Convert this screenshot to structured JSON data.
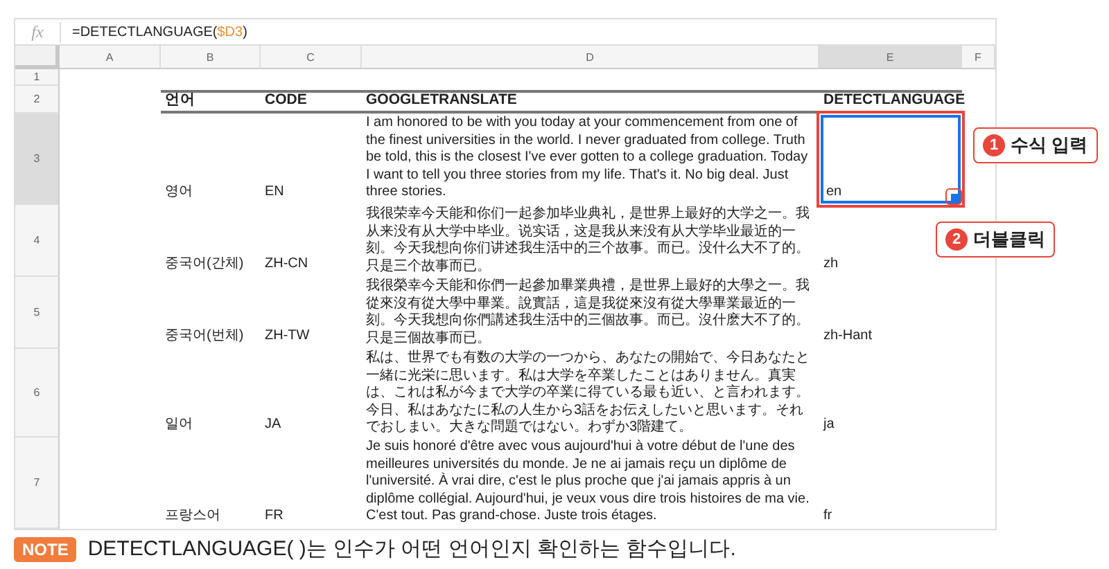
{
  "formula_bar": {
    "function_label": "fx",
    "prefix": "=DETECTLANGUAGE(",
    "ref": "$D3",
    "suffix": ")"
  },
  "column_headers": [
    {
      "label": "A",
      "selected": false
    },
    {
      "label": "B",
      "selected": false
    },
    {
      "label": "C",
      "selected": false
    },
    {
      "label": "D",
      "selected": false
    },
    {
      "label": "E",
      "selected": true
    },
    {
      "label": "F",
      "selected": false
    }
  ],
  "row_headers": [
    {
      "label": "1",
      "selected": false
    },
    {
      "label": "2",
      "selected": false
    },
    {
      "label": "3",
      "selected": true
    },
    {
      "label": "4",
      "selected": false
    },
    {
      "label": "5",
      "selected": false
    },
    {
      "label": "6",
      "selected": false
    },
    {
      "label": "7",
      "selected": false
    }
  ],
  "table": {
    "header": [
      "언어",
      "CODE",
      "GOOGLETRANSLATE",
      "DETECTLANGUAGE"
    ],
    "rows": [
      {
        "language": "영어",
        "code": "EN",
        "translation": "I am honored to be with you today at your commencement from one of the finest universities in the world. I never graduated from college. Truth be told, this is the closest I've ever gotten to a college graduation. Today I want to tell you three stories from my life. That's it. No big deal. Just three stories.",
        "detected": "en",
        "selected": true
      },
      {
        "language": "중국어(간체)",
        "code": "ZH-CN",
        "translation": "我很荣幸今天能和你们一起参加毕业典礼，是世界上最好的大学之一。我从来没有从大学中毕业。说实话，这是我从来没有从大学毕业最近的一刻。今天我想向你们讲述我生活中的三个故事。而已。没什么大不了的。只是三个故事而已。",
        "detected": "zh",
        "selected": false
      },
      {
        "language": "중국어(번체)",
        "code": "ZH-TW",
        "translation": "我很榮幸今天能和你們一起參加畢業典禮，是世界上最好的大學之一。我從來沒有從大學中畢業。說實話，這是我從來沒有從大學畢業最近的一刻。今天我想向你們講述我生活中的三個故事。而已。沒什麽大不了的。只是三個故事而已。",
        "detected": "zh-Hant",
        "selected": false
      },
      {
        "language": "일어",
        "code": "JA",
        "translation": "私は、世界でも有数の大学の一つから、あなたの開始で、今日あなたと一緒に光栄に思います。私は大学を卒業したことはありません。真実は、これは私が今まで大学の卒業に得ている最も近い、と言われます。今日、私はあなたに私の人生から3話をお伝えしたいと思います。それでおしまい。大きな問題ではない。わずか3階建て。",
        "detected": "ja",
        "selected": false
      },
      {
        "language": "프랑스어",
        "code": "FR",
        "translation": "Je suis honoré d'être avec vous aujourd'hui à votre début de l'une des meilleures universités du monde. Je ne ai jamais reçu un diplôme de l'université. À vrai dire, c'est le plus proche que j'ai jamais appris à un diplôme collégial. Aujourd'hui, je veux vous dire trois histoires de ma vie. C'est tout. Pas grand-chose. Juste trois étages.",
        "detected": "fr",
        "selected": false
      }
    ]
  },
  "callouts": [
    {
      "number": "1",
      "label": "수식 입력"
    },
    {
      "number": "2",
      "label": "더블클릭"
    }
  ],
  "note": {
    "badge": "NOTE",
    "text": "DETECTLANGUAGE( )는 인수가 어떤 언어인지 확인하는 함수입니다."
  }
}
